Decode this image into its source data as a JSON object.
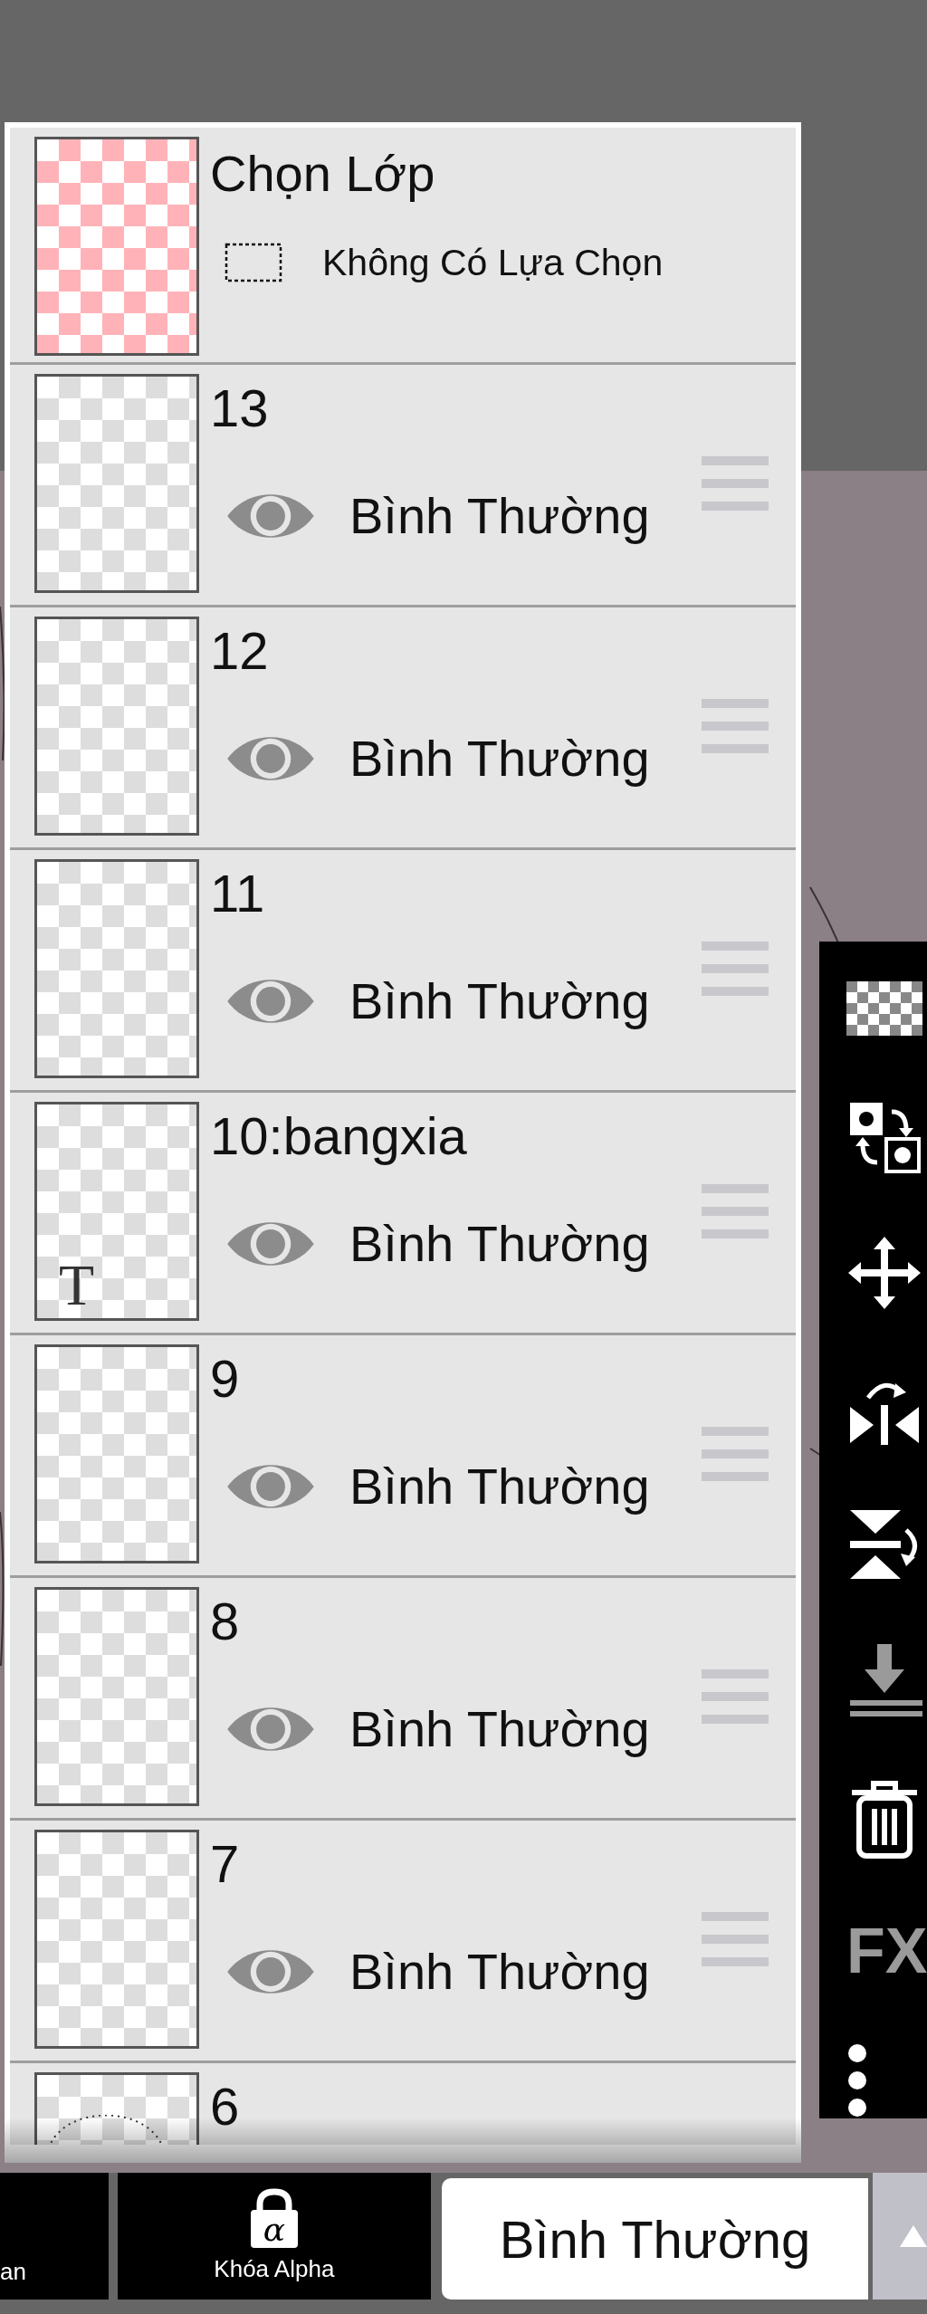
{
  "selection_layer": {
    "title": "Chọn Lớp",
    "selection": "Không Có Lựa Chọn"
  },
  "layers": [
    {
      "name": "13",
      "kind": "raster",
      "visible": true,
      "blend": "Bình Thường"
    },
    {
      "name": "12",
      "kind": "raster",
      "visible": true,
      "blend": "Bình Thường"
    },
    {
      "name": "11",
      "kind": "raster",
      "visible": true,
      "blend": "Bình Thường"
    },
    {
      "name": "10:bangxia",
      "kind": "text",
      "badge": "T",
      "visible": true,
      "blend": "Bình Thường"
    },
    {
      "name": "9",
      "kind": "raster",
      "visible": true,
      "blend": "Bình Thường"
    },
    {
      "name": "8",
      "kind": "raster",
      "visible": true,
      "blend": "Bình Thường"
    },
    {
      "name": "7",
      "kind": "raster",
      "visible": true,
      "blend": "Bình Thường"
    },
    {
      "name": "6",
      "kind": "sketch",
      "partial": true
    }
  ],
  "toolbar": [
    {
      "kind": "transparency",
      "disabled": false
    },
    {
      "kind": "swap",
      "disabled": false
    },
    {
      "kind": "move",
      "disabled": false
    },
    {
      "kind": "flip-horizontal",
      "disabled": false
    },
    {
      "kind": "flip-vertical",
      "disabled": false
    },
    {
      "kind": "merge-down",
      "disabled": true
    },
    {
      "kind": "delete",
      "disabled": false
    },
    {
      "kind": "fx",
      "label": "FX",
      "disabled": true
    },
    {
      "kind": "more",
      "disabled": false
    }
  ],
  "bottom_bar": {
    "clipped_button": "an",
    "alpha_lock": {
      "glyph": "α",
      "label": "Khóa Alpha"
    },
    "blend_mode": "Bình Thường"
  }
}
